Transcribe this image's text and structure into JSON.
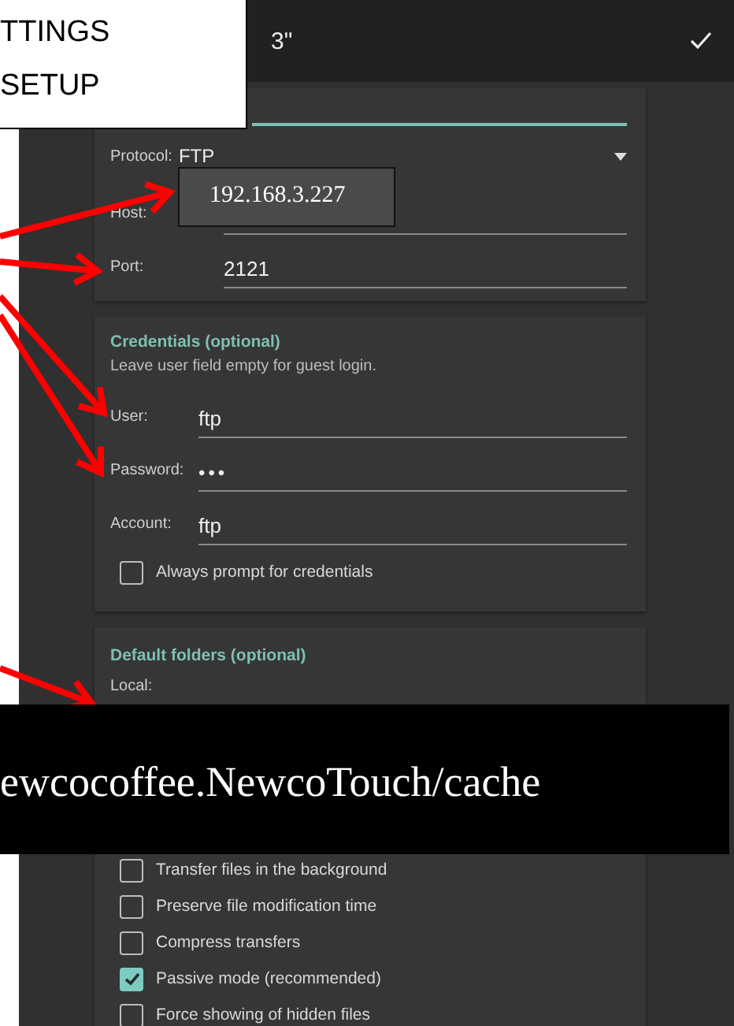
{
  "callout": {
    "lines": [
      "TTINGS",
      "SETUP"
    ]
  },
  "toolbar": {
    "title": "3\""
  },
  "server": {
    "protocol": {
      "label": "Protocol:",
      "value": "FTP"
    },
    "host": {
      "label": "Host:",
      "overlay": "192.168.3.227"
    },
    "port": {
      "label": "Port:",
      "value": "2121"
    }
  },
  "credentials": {
    "title": "Credentials (optional)",
    "note": "Leave user field empty for guest login.",
    "fields": [
      {
        "kind": "text",
        "label": "User:",
        "value": "ftp"
      },
      {
        "kind": "password",
        "label": "Password:",
        "value": "•••"
      },
      {
        "kind": "text",
        "label": "Account:",
        "value": "ftp"
      }
    ],
    "prompt": {
      "label": "Always prompt for credentials",
      "checked": false
    }
  },
  "folders": {
    "title": "Default folders (optional)",
    "local_label": "Local:",
    "banner": "ewcocoffee.NewcoTouch/cache"
  },
  "options": [
    {
      "label": "Transfer files in the background",
      "checked": false
    },
    {
      "label": "Preserve file modification time",
      "checked": false
    },
    {
      "label": "Compress transfers",
      "checked": false
    },
    {
      "label": "Passive mode (recommended)",
      "checked": true
    },
    {
      "label": "Force showing of hidden files",
      "checked": false
    }
  ]
}
